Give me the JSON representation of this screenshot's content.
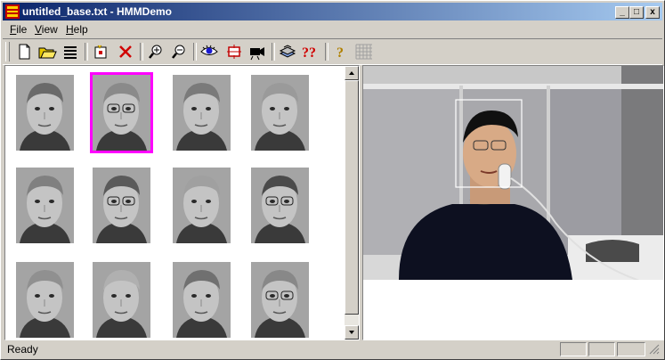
{
  "window": {
    "title": "untitled_base.txt - HMMDemo"
  },
  "titlebar_buttons": {
    "minimize": "_",
    "maximize": "□",
    "close": "x"
  },
  "menu": [
    {
      "label": "File",
      "hotkey": "F",
      "rest": "ile"
    },
    {
      "label": "View",
      "hotkey": "V",
      "rest": "iew"
    },
    {
      "label": "Help",
      "hotkey": "H",
      "rest": "elp"
    }
  ],
  "toolbar": [
    "new-file",
    "open-folder",
    "list",
    "add-face",
    "delete",
    "zoom-in",
    "zoom-out",
    "eye",
    "frame",
    "camera",
    "stack",
    "double-question",
    "help-question",
    "grid"
  ],
  "face_gallery": {
    "count": 12,
    "selected_index": 1
  },
  "status": {
    "text": "Ready"
  },
  "colors": {
    "selection": "#ff00ff",
    "title_start": "#0a246a",
    "title_end": "#a6caf0"
  }
}
